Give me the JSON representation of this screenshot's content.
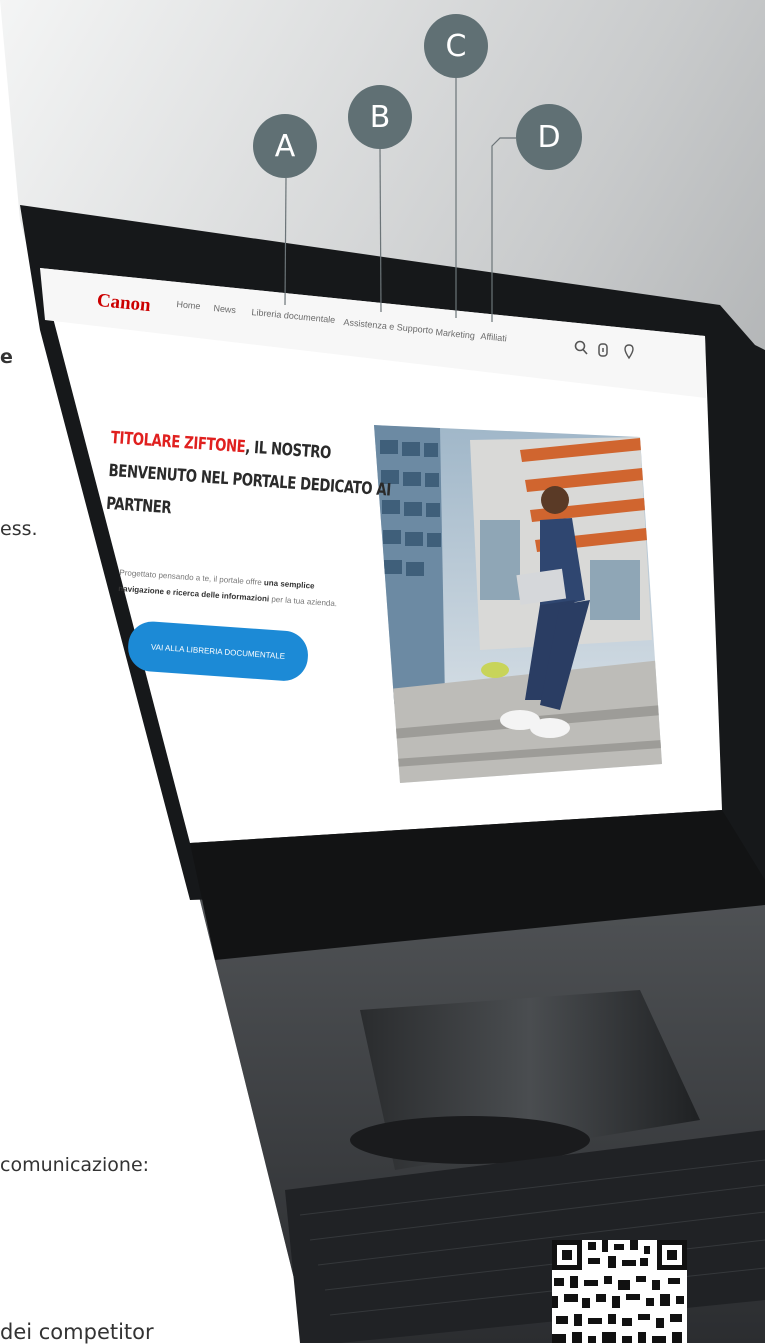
{
  "left_text": {
    "fragment_1": "e",
    "fragment_2": "ess.",
    "fragment_3": "comunicazione:",
    "fragment_4": "dei competitor"
  },
  "badges": [
    "A",
    "B",
    "C",
    "D"
  ],
  "screen": {
    "logo": "Canon",
    "nav": [
      "Home",
      "News",
      "Libreria documentale",
      "Assistenza e Supporto",
      "Marketing",
      "Affiliati"
    ],
    "hero": {
      "title_accent": "TITOLARE ZIFTONE",
      "title_rest_1": ", IL NOSTRO",
      "title_rest_2": "BENVENUTO NEL PORTALE DEDICATO AI",
      "title_rest_3": "PARTNER",
      "desc_1": "Progettato pensando a te, il portale offre",
      "desc_bold_1": "una semplice",
      "desc_bold_2": "navigazione e ricerca delle informazioni",
      "desc_2": "per la tua azienda.",
      "cta": "VAI ALLA LIBRERIA DOCUMENTALE"
    }
  },
  "colors": {
    "badge": "#607074",
    "canon_red": "#cc0000",
    "cta_blue": "#1c8ad6",
    "title_red": "#e0201f"
  }
}
